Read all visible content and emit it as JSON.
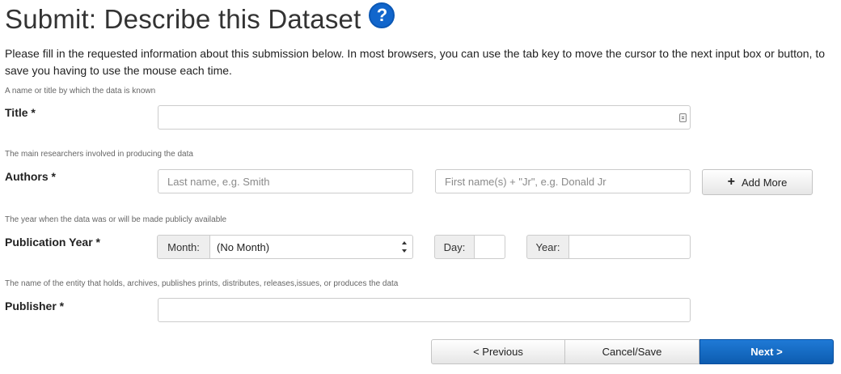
{
  "header": {
    "title": "Submit: Describe this Dataset",
    "help_glyph": "?"
  },
  "intro": "Please fill in the requested information about this submission below. In most browsers, you can use the tab key to move the cursor to the next input box or button, to save you having to use the mouse each time.",
  "fields": {
    "title": {
      "hint": "A name or title by which the data is known",
      "label": "Title *",
      "value": "",
      "placeholder": ""
    },
    "authors": {
      "hint": "The main researchers involved in producing the data",
      "label": "Authors *",
      "last_name_placeholder": "Last name, e.g. Smith",
      "first_name_placeholder": "First name(s) + \"Jr\", e.g. Donald Jr",
      "add_more_label": "Add More",
      "add_more_glyph": "+"
    },
    "publication_year": {
      "hint": "The year when the data was or will be made publicly available",
      "label": "Publication Year *",
      "month_label": "Month:",
      "month_selected": "(No Month)",
      "day_label": "Day:",
      "year_label": "Year:"
    },
    "publisher": {
      "hint": "The name of the entity that holds, archives, publishes prints, distributes, releases,issues, or produces the data",
      "label": "Publisher *",
      "value": ""
    }
  },
  "footer": {
    "previous_label": "< Previous",
    "cancel_label": "Cancel/Save",
    "next_label": "Next >"
  },
  "colors": {
    "accent": "#1166cc",
    "primary_button": "#0d5cb0"
  },
  "icons": {
    "help": "question-circle-icon",
    "add": "plus-icon",
    "select": "select-arrows-icon",
    "field": "field-autofill-icon"
  }
}
